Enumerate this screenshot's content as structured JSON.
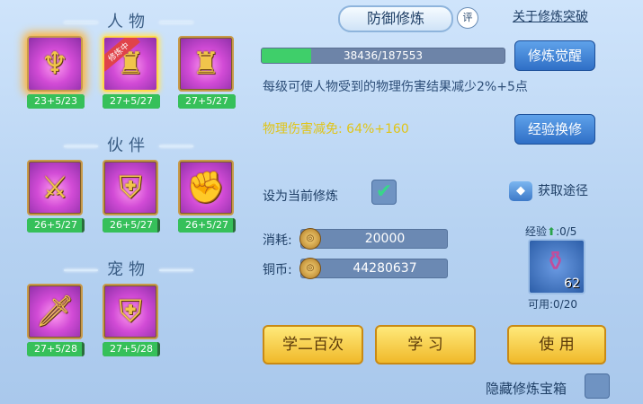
{
  "sections": {
    "characters": {
      "title": "人物",
      "items": [
        {
          "icon": "monk-icon",
          "level": "23+5/23",
          "fill": 1.0,
          "fire": true
        },
        {
          "icon": "armor-icon",
          "level": "27+5/27",
          "fill": 1.0,
          "badge": "修炼中",
          "selected": true
        },
        {
          "icon": "armor-icon",
          "level": "27+5/27",
          "fill": 1.0
        }
      ]
    },
    "partners": {
      "title": "伙伴",
      "items": [
        {
          "icon": "sword-lion-icon",
          "level": "26+5/27",
          "fill": 0.96
        },
        {
          "icon": "shield-lion-icon",
          "level": "26+5/27",
          "fill": 0.96
        },
        {
          "icon": "gauntlet-lion-icon",
          "level": "26+5/27",
          "fill": 0.96
        }
      ]
    },
    "pets": {
      "title": "宠物",
      "items": [
        {
          "icon": "sword-cat-icon",
          "level": "27+5/28",
          "fill": 0.96
        },
        {
          "icon": "shield-cat-icon",
          "level": "27+5/28",
          "fill": 0.96
        }
      ]
    }
  },
  "header": {
    "title": "防御修炼",
    "rate_icon": "评",
    "breakthrough": "关于修炼突破"
  },
  "progress": {
    "text": "38436/187553",
    "value": 0.205
  },
  "buttons": {
    "awaken": "修炼觉醒",
    "exp_swap": "经验换修",
    "learn_200": "学二百次",
    "learn": "学 习",
    "use": "使 用"
  },
  "description": "每级可使人物受到的物理伤害结果减少2%+5点",
  "stat": {
    "label": "物理伤害减免:",
    "value": "64%+160"
  },
  "set_current": "设为当前修炼",
  "source": "获取途径",
  "costs": {
    "consume_label": "消耗:",
    "consume_value": "20000",
    "coin_label": "铜币:",
    "coin_value": "44280637"
  },
  "item": {
    "exp_label": "经验",
    "exp_value": ":0/5",
    "count": "62",
    "usable": "可用:0/20"
  },
  "hide_chest": "隐藏修炼宝箱",
  "colors": {
    "accent_gold": "#f0b92a",
    "accent_blue": "#2f6fc6",
    "bar_green": "#36c05a"
  }
}
